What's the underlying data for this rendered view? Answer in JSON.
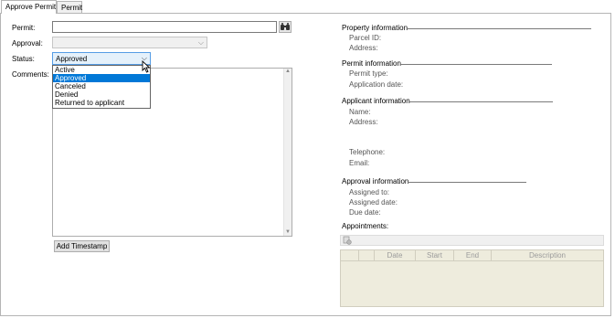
{
  "tabs": [
    {
      "label": "Approve Permit"
    },
    {
      "label": "Permit"
    }
  ],
  "form": {
    "permit_label": "Permit:",
    "permit_value": "",
    "approval_label": "Approval:",
    "approval_value": "",
    "status_label": "Status:",
    "status_value": "Approved",
    "comments_label": "Comments:",
    "comments_value": "",
    "timestamp_button": "Add Timestamp"
  },
  "status_options": [
    "Active",
    "Approved",
    "Canceled",
    "Denied",
    "Returned to applicant"
  ],
  "status_selected_index": 1,
  "property_info": {
    "title": "Property information",
    "parcel_id_label": "Parcel ID:",
    "address_label": "Address:"
  },
  "permit_info": {
    "title": "Permit information",
    "permit_type_label": "Permit type:",
    "application_date_label": "Application date:"
  },
  "applicant_info": {
    "title": "Applicant information",
    "name_label": "Name:",
    "address_label": "Address:",
    "telephone_label": "Telephone:",
    "email_label": "Email:"
  },
  "approval_info": {
    "title": "Approval information",
    "assigned_to_label": "Assigned to:",
    "assigned_date_label": "Assigned date:",
    "due_date_label": "Due date:"
  },
  "appointments": {
    "title": "Appointments:",
    "columns": [
      "",
      "",
      "Date",
      "Start",
      "End",
      "Description"
    ]
  },
  "colors": {
    "selection": "#0078d7",
    "focus_border": "#569de5",
    "grid_bg": "#ece9d8"
  }
}
